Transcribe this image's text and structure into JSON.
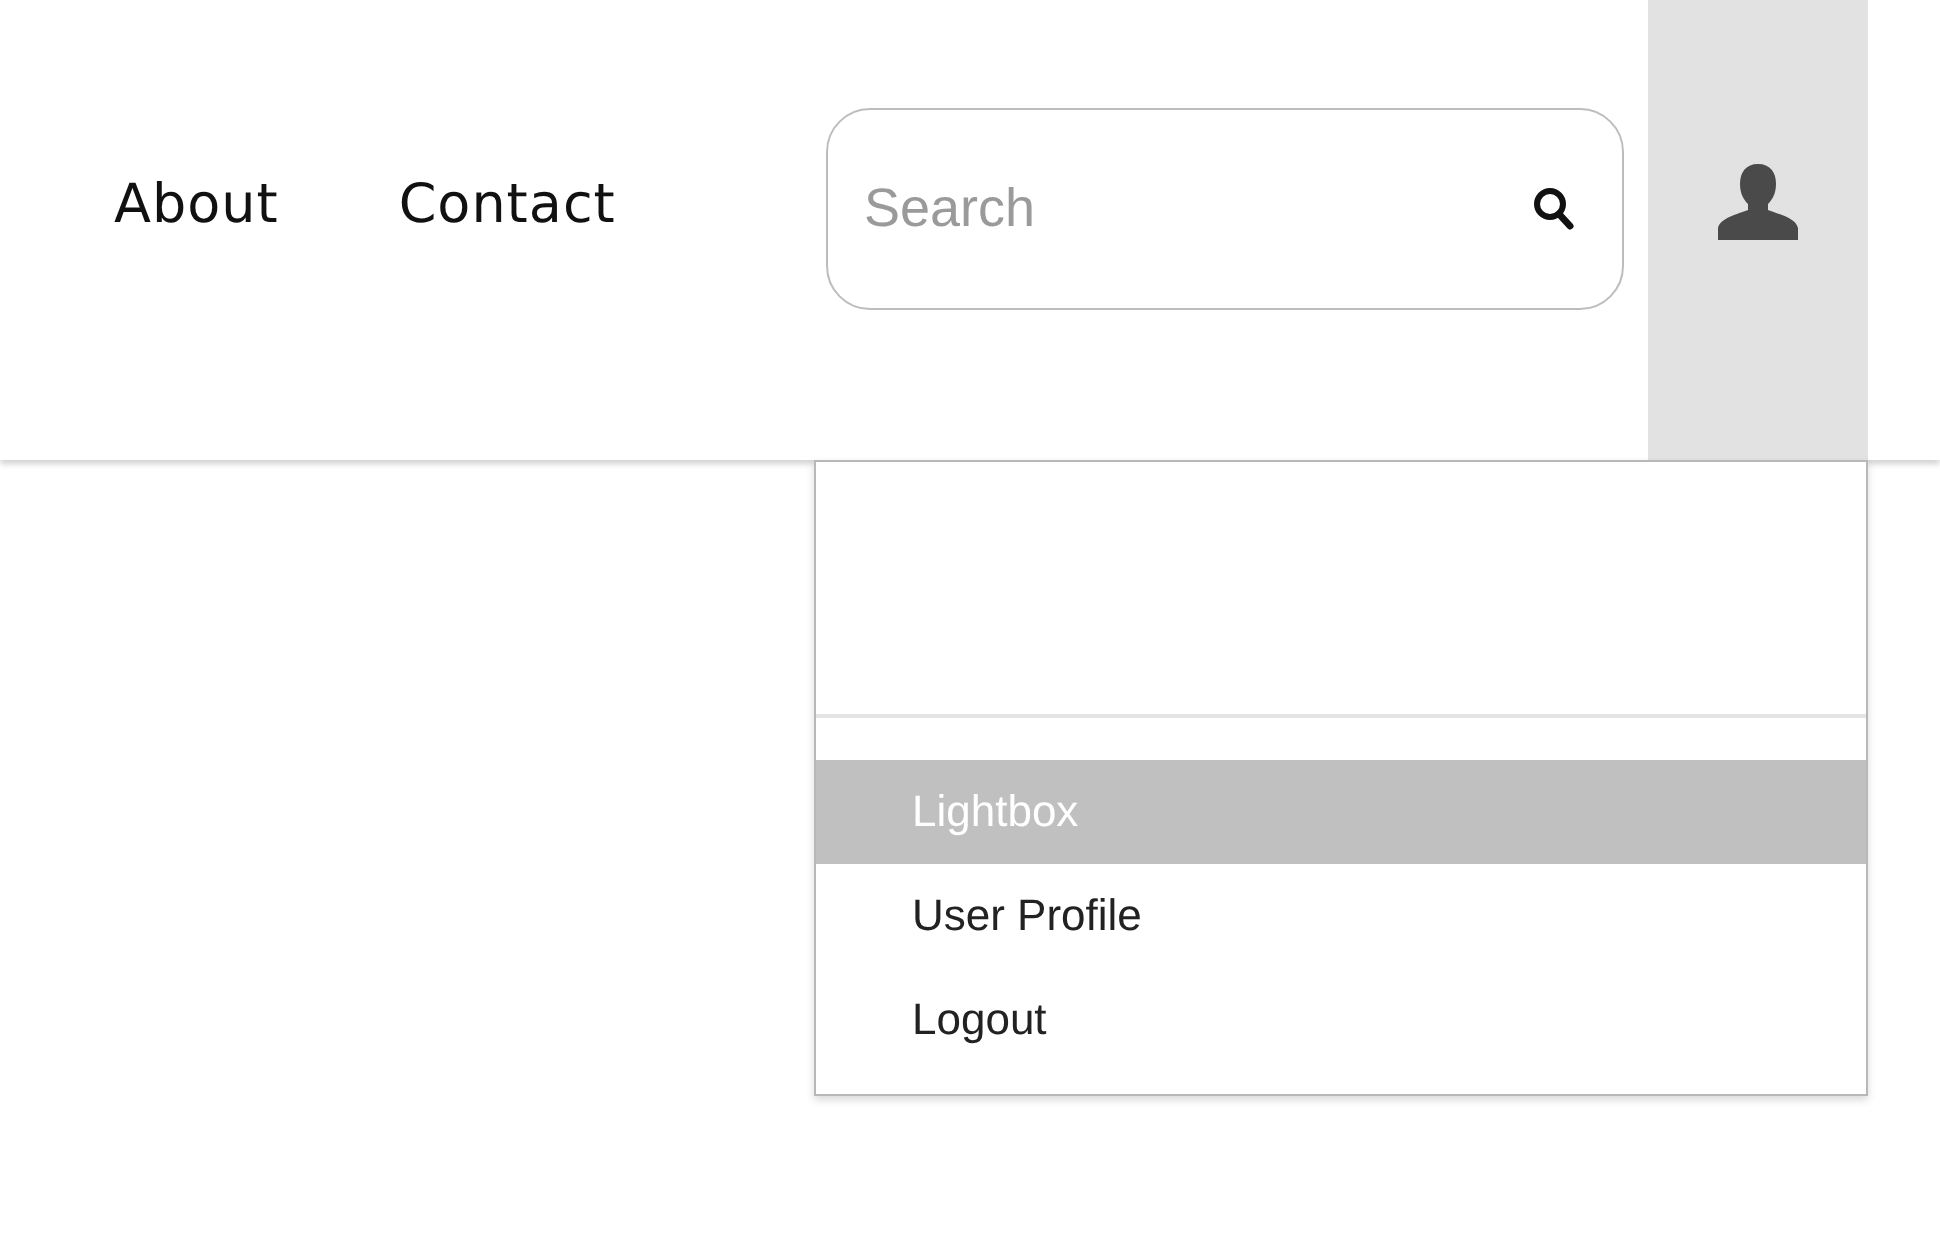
{
  "nav": {
    "links": [
      {
        "label": "About"
      },
      {
        "label": "Contact"
      }
    ]
  },
  "search": {
    "placeholder": "Search"
  },
  "user_button": {
    "expanded": true
  },
  "user_menu": {
    "items": [
      {
        "label": "Lightbox",
        "selected": true
      },
      {
        "label": "User Profile",
        "selected": false
      },
      {
        "label": "Logout",
        "selected": false
      }
    ]
  }
}
